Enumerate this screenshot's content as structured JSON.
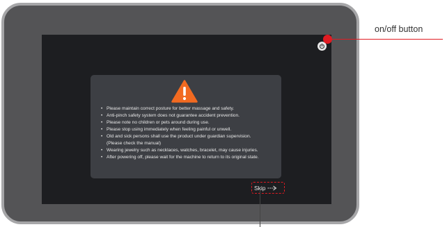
{
  "callout": {
    "power_label": "on/off button"
  },
  "dialog": {
    "notices": [
      "Please maintain correct posture for better massage and safety.",
      "Anti-pinch safety system does not guarantee accident prevention.",
      "Please note no children or pets around during use.",
      "Please stop using immediately when feeling painful or unwell.",
      "Old and sick persons shall use the product under guardian supervision.",
      "(Please check the manual)",
      "Wearing jewelry  such as necklaces, watches, bracelet, may cause injuries.",
      "After powering off, please wait for the machine to return to its original state."
    ],
    "skip_label": "Skip"
  },
  "icons": {
    "warning": "warning-triangle-icon",
    "power": "power-icon",
    "skip_arrow": "arrow-right-icon"
  },
  "colors": {
    "warning_orange": "#f26a21",
    "callout_red": "#e11b22",
    "screen_bg": "#1d1e21",
    "dialog_bg": "#3d3f44",
    "bezel": "#545456"
  }
}
